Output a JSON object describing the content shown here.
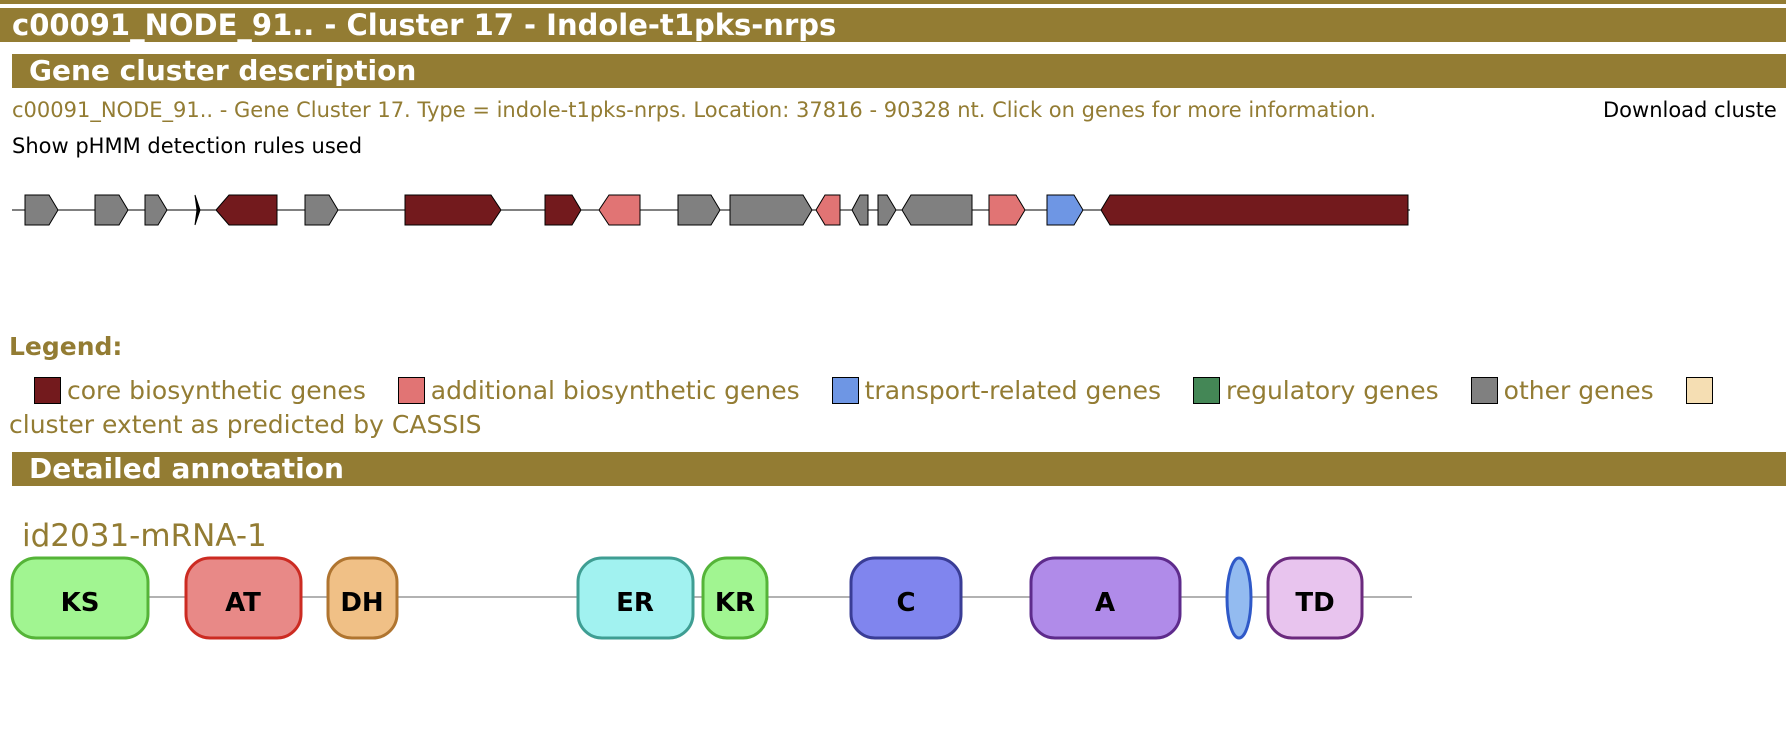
{
  "header": {
    "title": "c00091_NODE_91.. - Cluster 17 - Indole-t1pks-nrps"
  },
  "description": {
    "section_title": "Gene cluster description",
    "text": "c00091_NODE_91.. - Gene Cluster 17. Type = indole-t1pks-nrps. Location: 37816 - 90328 nt. Click on genes for more information.",
    "download_label": "Download cluste",
    "rules_link": "Show pHMM detection rules used"
  },
  "colors": {
    "brand": "#937c33",
    "core": "#731a1d",
    "additional": "#e17474",
    "transport": "#6e96e4",
    "regulatory": "#448756",
    "other": "#808080",
    "cassis": "#f5deb3"
  },
  "legend": {
    "title": "Legend:",
    "items": [
      {
        "label": "core biosynthetic genes",
        "color": "#731a1d"
      },
      {
        "label": "additional biosynthetic genes",
        "color": "#e17474"
      },
      {
        "label": "transport-related genes",
        "color": "#6e96e4"
      },
      {
        "label": "regulatory genes",
        "color": "#448756"
      },
      {
        "label": "other genes",
        "color": "#808080"
      }
    ],
    "cassis_color": "#f5deb3",
    "cassis_label": "cluster extent as predicted by CASSIS"
  },
  "detailed": {
    "section_title": "Detailed annotation",
    "protein_name": "id2031-mRNA-1",
    "domains": [
      {
        "label": "KS",
        "fill": "#a1f591",
        "stroke": "#55b438"
      },
      {
        "label": "AT",
        "fill": "#e88987",
        "stroke": "#cc2b22"
      },
      {
        "label": "DH",
        "fill": "#f0c086",
        "stroke": "#b07530"
      },
      {
        "label": "ER",
        "fill": "#a1f2f0",
        "stroke": "#3f9e93"
      },
      {
        "label": "KR",
        "fill": "#a1f591",
        "stroke": "#55b438"
      },
      {
        "label": "C",
        "fill": "#8085ee",
        "stroke": "#3a3d96"
      },
      {
        "label": "A",
        "fill": "#b08be9",
        "stroke": "#5e2b8c"
      },
      {
        "label": "",
        "fill": "#93bbf0",
        "stroke": "#2f59c8"
      },
      {
        "label": "TD",
        "fill": "#e8c4ee",
        "stroke": "#6b2a7e"
      }
    ]
  }
}
